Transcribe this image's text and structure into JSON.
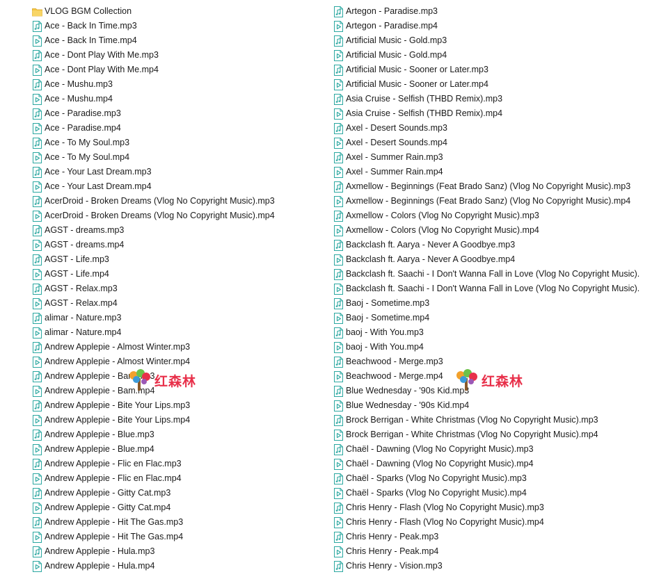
{
  "icons": {
    "folder": "folder-icon",
    "mp3": "audio-file-icon",
    "mp4": "video-file-icon"
  },
  "colors": {
    "folder": "#f5c542",
    "file_stroke": "#2aa7a0",
    "watermark_text": "#e8304a"
  },
  "watermark": {
    "text": "红森林"
  },
  "left_column": [
    {
      "name": "VLOG BGM Collection",
      "type": "folder"
    },
    {
      "name": "Ace - Back In Time.mp3",
      "type": "mp3"
    },
    {
      "name": "Ace - Back In Time.mp4",
      "type": "mp4"
    },
    {
      "name": "Ace - Dont Play With Me.mp3",
      "type": "mp3"
    },
    {
      "name": "Ace - Dont Play With Me.mp4",
      "type": "mp4"
    },
    {
      "name": "Ace - Mushu.mp3",
      "type": "mp3"
    },
    {
      "name": "Ace - Mushu.mp4",
      "type": "mp4"
    },
    {
      "name": "Ace - Paradise.mp3",
      "type": "mp3"
    },
    {
      "name": "Ace - Paradise.mp4",
      "type": "mp4"
    },
    {
      "name": "Ace - To My Soul.mp3",
      "type": "mp3"
    },
    {
      "name": "Ace - To My Soul.mp4",
      "type": "mp4"
    },
    {
      "name": "Ace - Your Last Dream.mp3",
      "type": "mp3"
    },
    {
      "name": "Ace - Your Last Dream.mp4",
      "type": "mp4"
    },
    {
      "name": "AcerDroid - Broken Dreams (Vlog No Copyright Music).mp3",
      "type": "mp3"
    },
    {
      "name": "AcerDroid - Broken Dreams (Vlog No Copyright Music).mp4",
      "type": "mp4"
    },
    {
      "name": "AGST - dreams.mp3",
      "type": "mp3"
    },
    {
      "name": "AGST - dreams.mp4",
      "type": "mp4"
    },
    {
      "name": "AGST - Life.mp3",
      "type": "mp3"
    },
    {
      "name": "AGST - Life.mp4",
      "type": "mp4"
    },
    {
      "name": "AGST - Relax.mp3",
      "type": "mp3"
    },
    {
      "name": "AGST - Relax.mp4",
      "type": "mp4"
    },
    {
      "name": "alimar - Nature.mp3",
      "type": "mp3"
    },
    {
      "name": "alimar - Nature.mp4",
      "type": "mp4"
    },
    {
      "name": "Andrew Applepie - Almost Winter.mp3",
      "type": "mp3"
    },
    {
      "name": "Andrew Applepie - Almost Winter.mp4",
      "type": "mp4"
    },
    {
      "name": "Andrew Applepie - Bam.mp3",
      "type": "mp3"
    },
    {
      "name": "Andrew Applepie - Bam.mp4",
      "type": "mp4"
    },
    {
      "name": "Andrew Applepie - Bite Your Lips.mp3",
      "type": "mp3"
    },
    {
      "name": "Andrew Applepie - Bite Your Lips.mp4",
      "type": "mp4"
    },
    {
      "name": "Andrew Applepie - Blue.mp3",
      "type": "mp3"
    },
    {
      "name": "Andrew Applepie - Blue.mp4",
      "type": "mp4"
    },
    {
      "name": "Andrew Applepie - Flic en Flac.mp3",
      "type": "mp3"
    },
    {
      "name": "Andrew Applepie - Flic en Flac.mp4",
      "type": "mp4"
    },
    {
      "name": "Andrew Applepie - Gitty Cat.mp3",
      "type": "mp3"
    },
    {
      "name": "Andrew Applepie - Gitty Cat.mp4",
      "type": "mp4"
    },
    {
      "name": "Andrew Applepie - Hit The Gas.mp3",
      "type": "mp3"
    },
    {
      "name": "Andrew Applepie - Hit The Gas.mp4",
      "type": "mp4"
    },
    {
      "name": "Andrew Applepie - Hula.mp3",
      "type": "mp3"
    },
    {
      "name": "Andrew Applepie - Hula.mp4",
      "type": "mp4"
    }
  ],
  "right_column": [
    {
      "name": "Artegon - Paradise.mp3",
      "type": "mp3"
    },
    {
      "name": "Artegon - Paradise.mp4",
      "type": "mp4"
    },
    {
      "name": "Artificial Music - Gold.mp3",
      "type": "mp3"
    },
    {
      "name": "Artificial Music - Gold.mp4",
      "type": "mp4"
    },
    {
      "name": "Artificial Music - Sooner or Later.mp3",
      "type": "mp3"
    },
    {
      "name": "Artificial Music - Sooner or Later.mp4",
      "type": "mp4"
    },
    {
      "name": "Asia Cruise - Selfish (THBD Remix).mp3",
      "type": "mp3"
    },
    {
      "name": "Asia Cruise - Selfish (THBD Remix).mp4",
      "type": "mp4"
    },
    {
      "name": "Axel - Desert Sounds.mp3",
      "type": "mp3"
    },
    {
      "name": "Axel - Desert Sounds.mp4",
      "type": "mp4"
    },
    {
      "name": "Axel - Summer Rain.mp3",
      "type": "mp3"
    },
    {
      "name": "Axel - Summer Rain.mp4",
      "type": "mp4"
    },
    {
      "name": "Axmellow - Beginnings (Feat Brado Sanz) (Vlog No Copyright Music).mp3",
      "type": "mp3"
    },
    {
      "name": "Axmellow - Beginnings (Feat Brado Sanz) (Vlog No Copyright Music).mp4",
      "type": "mp4"
    },
    {
      "name": "Axmellow - Colors (Vlog No Copyright Music).mp3",
      "type": "mp3"
    },
    {
      "name": "Axmellow - Colors (Vlog No Copyright Music).mp4",
      "type": "mp4"
    },
    {
      "name": "Backclash ft. Aarya - Never A Goodbye.mp3",
      "type": "mp3"
    },
    {
      "name": "Backclash ft. Aarya - Never A Goodbye.mp4",
      "type": "mp4"
    },
    {
      "name": "Backclash ft. Saachi - I Don't Wanna Fall in Love (Vlog No Copyright Music).",
      "type": "mp3"
    },
    {
      "name": "Backclash ft. Saachi - I Don't Wanna Fall in Love (Vlog No Copyright Music).",
      "type": "mp4"
    },
    {
      "name": "Baoj - Sometime.mp3",
      "type": "mp3"
    },
    {
      "name": "Baoj - Sometime.mp4",
      "type": "mp4"
    },
    {
      "name": "baoj - With You.mp3",
      "type": "mp3"
    },
    {
      "name": "baoj - With You.mp4",
      "type": "mp4"
    },
    {
      "name": "Beachwood - Merge.mp3",
      "type": "mp3"
    },
    {
      "name": "Beachwood - Merge.mp4",
      "type": "mp4"
    },
    {
      "name": "Blue Wednesday - '90s Kid.mp3",
      "type": "mp3"
    },
    {
      "name": "Blue Wednesday - '90s Kid.mp4",
      "type": "mp4"
    },
    {
      "name": "Brock Berrigan - White Christmas (Vlog No Copyright Music).mp3",
      "type": "mp3"
    },
    {
      "name": "Brock Berrigan - White Christmas (Vlog No Copyright Music).mp4",
      "type": "mp4"
    },
    {
      "name": "Chaël - Dawning (Vlog No Copyright Music).mp3",
      "type": "mp3"
    },
    {
      "name": "Chaël - Dawning (Vlog No Copyright Music).mp4",
      "type": "mp4"
    },
    {
      "name": "Chaël - Sparks (Vlog No Copyright Music).mp3",
      "type": "mp3"
    },
    {
      "name": "Chaël - Sparks (Vlog No Copyright Music).mp4",
      "type": "mp4"
    },
    {
      "name": "Chris Henry - Flash (Vlog No Copyright Music).mp3",
      "type": "mp3"
    },
    {
      "name": "Chris Henry - Flash (Vlog No Copyright Music).mp4",
      "type": "mp4"
    },
    {
      "name": "Chris Henry - Peak.mp3",
      "type": "mp3"
    },
    {
      "name": "Chris Henry - Peak.mp4",
      "type": "mp4"
    },
    {
      "name": "Chris Henry - Vision.mp3",
      "type": "mp3"
    }
  ]
}
